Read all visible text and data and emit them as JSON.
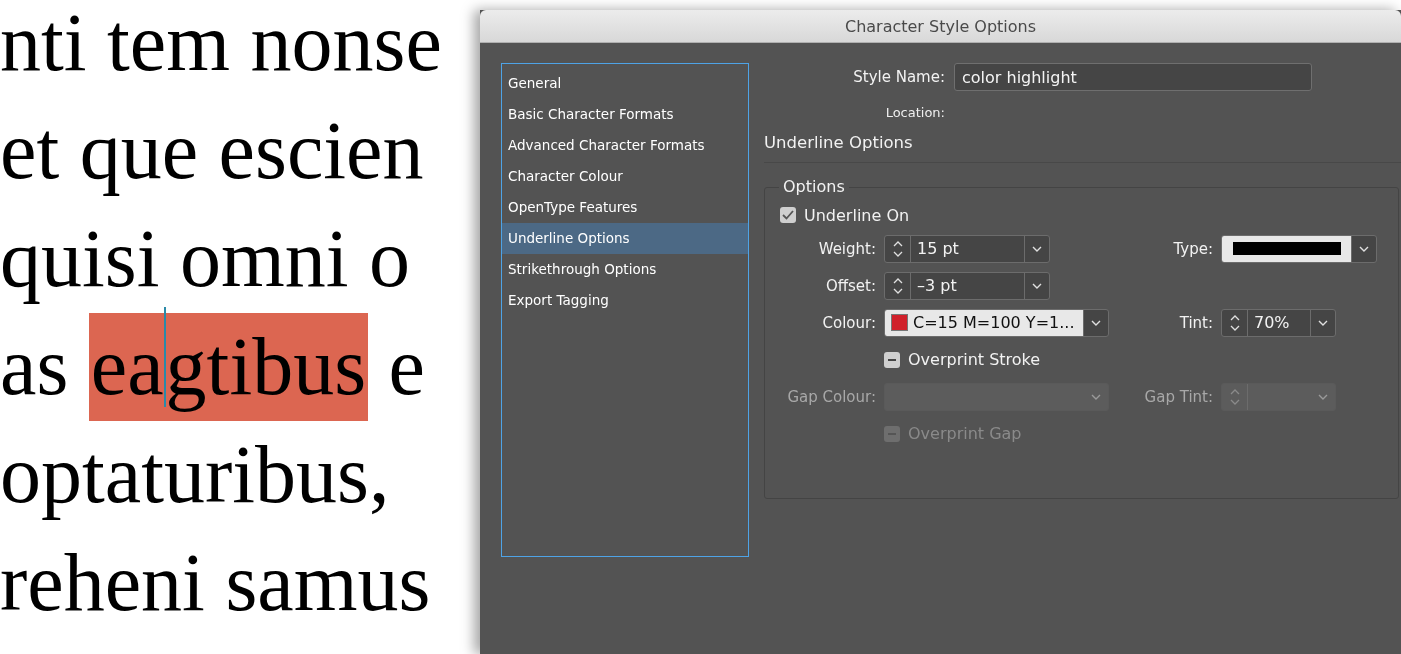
{
  "document": {
    "lines": [
      {
        "segments": [
          {
            "kind": "plain",
            "text": "nti tem nonse"
          }
        ]
      },
      {
        "segments": [
          {
            "kind": "plain",
            "text": "et que escien"
          }
        ]
      },
      {
        "segments": [
          {
            "kind": "plain",
            "text": "quisi omni o"
          }
        ]
      },
      {
        "segments": [
          {
            "kind": "plain",
            "text": "as "
          },
          {
            "kind": "highlight",
            "parts": [
              "ea",
              "gtibus"
            ]
          },
          {
            "kind": "plain",
            "text": " e"
          }
        ]
      },
      {
        "segments": [
          {
            "kind": "plain",
            "text": "optaturibus,"
          }
        ]
      },
      {
        "segments": [
          {
            "kind": "plain",
            "text": "reheni samus"
          }
        ]
      }
    ]
  },
  "dialog": {
    "title": "Character Style Options",
    "sidebar": {
      "items": [
        {
          "label": "General",
          "selected": false
        },
        {
          "label": "Basic Character Formats",
          "selected": false
        },
        {
          "label": "Advanced Character Formats",
          "selected": false
        },
        {
          "label": "Character Colour",
          "selected": false
        },
        {
          "label": "OpenType Features",
          "selected": false
        },
        {
          "label": "Underline Options",
          "selected": true
        },
        {
          "label": "Strikethrough Options",
          "selected": false
        },
        {
          "label": "Export Tagging",
          "selected": false
        }
      ]
    },
    "style_name": {
      "label": "Style Name:",
      "value": "color highlight"
    },
    "location": {
      "label": "Location:"
    },
    "section_title": "Underline Options",
    "group": {
      "legend": "Options",
      "rows": [
        {
          "kind": "checkbox",
          "label": "Underline On",
          "checked": true,
          "disabled": false
        },
        {
          "kind": "pair",
          "left": {
            "kind": "spin",
            "label": "Weight:",
            "value": "15 pt",
            "disabled": false
          },
          "right": {
            "kind": "linetype",
            "label": "Type:",
            "disabled": false
          }
        },
        {
          "kind": "pair",
          "left": {
            "kind": "spin",
            "label": "Offset:",
            "value": "–3 pt",
            "disabled": false
          }
        },
        {
          "kind": "pair",
          "left": {
            "kind": "swatch",
            "label": "Colour:",
            "value": "C=15 M=100 Y=1...",
            "color": "#d0202a",
            "disabled": false
          },
          "right": {
            "kind": "spin",
            "label": "Tint:",
            "value": "70%",
            "disabled": false
          }
        },
        {
          "kind": "sub_checkbox",
          "label": "Overprint Stroke",
          "checked": false,
          "mixed": true,
          "disabled": false
        },
        {
          "kind": "pair",
          "left": {
            "kind": "swatch",
            "label": "Gap Colour:",
            "disabled": true
          },
          "right": {
            "kind": "spin",
            "label": "Gap Tint:",
            "disabled": true
          }
        },
        {
          "kind": "sub_checkbox",
          "label": "Overprint Gap",
          "checked": false,
          "mixed": true,
          "disabled": true
        }
      ]
    }
  }
}
